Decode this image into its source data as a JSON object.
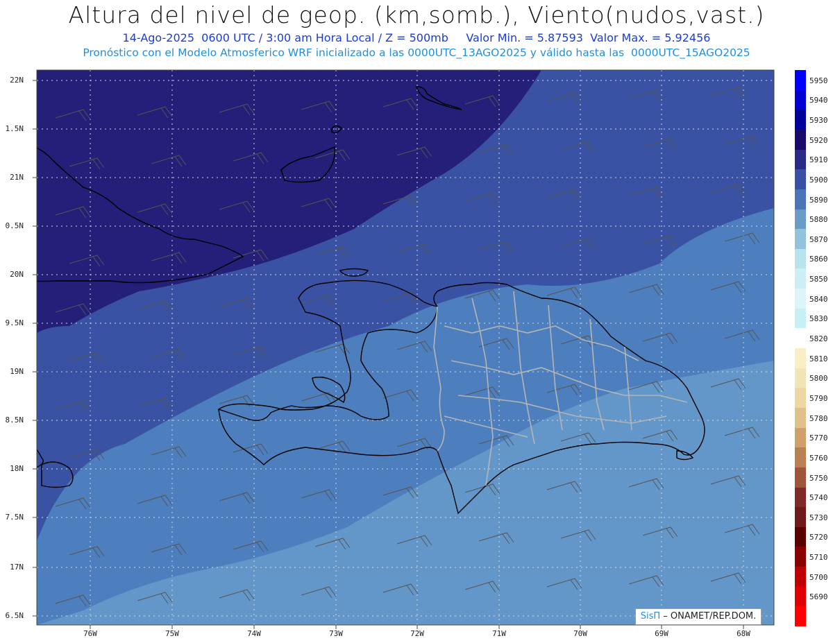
{
  "title": "Altura del nivel de geop. (km,somb.), Viento(nudos,vast.)",
  "subtitle_line1": "14-Ago-2025  0600 UTC / 3:00 am Hora Local / Z = 500mb     Valor Min. = 5.87593  Valor Max. = 5.92456",
  "subtitle_line2": "Pronóstico con el Modelo Atmosferico WRF inicializado a las 0000UTC_13AGO2025 y válido hasta las  0000UTC_15AGO2025",
  "y_labels": [
    "22N",
    "1.5N",
    "21N",
    "0.5N",
    "20N",
    "9.5N",
    "19N",
    "8.5N",
    "18N",
    "7.5N",
    "17N",
    "6.5N"
  ],
  "x_labels": [
    "76W",
    "75W",
    "74W",
    "73W",
    "72W",
    "71W",
    "70W",
    "69W",
    "68W"
  ],
  "colorbar": {
    "levels": [
      5950,
      5940,
      5930,
      5920,
      5910,
      5900,
      5890,
      5880,
      5870,
      5860,
      5850,
      5840,
      5830,
      5820,
      5810,
      5800,
      5790,
      5780,
      5770,
      5760,
      5750,
      5740,
      5730,
      5720,
      5710,
      5700,
      5690
    ],
    "colors": [
      "#0000ff",
      "#0000d0",
      "#00009a",
      "#180a6a",
      "#2a2a88",
      "#3a50a6",
      "#4a76b8",
      "#6a9cc9",
      "#92c2dc",
      "#b8e2ec",
      "#cdeef4",
      "#ddf5f8",
      "#c6f0f6",
      "#ffffff",
      "#f8efc6",
      "#f2e4b4",
      "#eed8a2",
      "#e2c08a",
      "#cfa06a",
      "#b98050",
      "#a0543a",
      "#7f2a28",
      "#6e1a1a",
      "#5a0000",
      "#8a0000",
      "#c00000",
      "#e00000",
      "#ff0000"
    ]
  },
  "map_colors": {
    "deep": "#241f78",
    "mid": "#3a52a4",
    "light": "#4d7ebd",
    "lighter": "#6497c9"
  },
  "credit": {
    "brand": "SisΠ",
    "text": " – ONAMET/REP.DOM."
  }
}
